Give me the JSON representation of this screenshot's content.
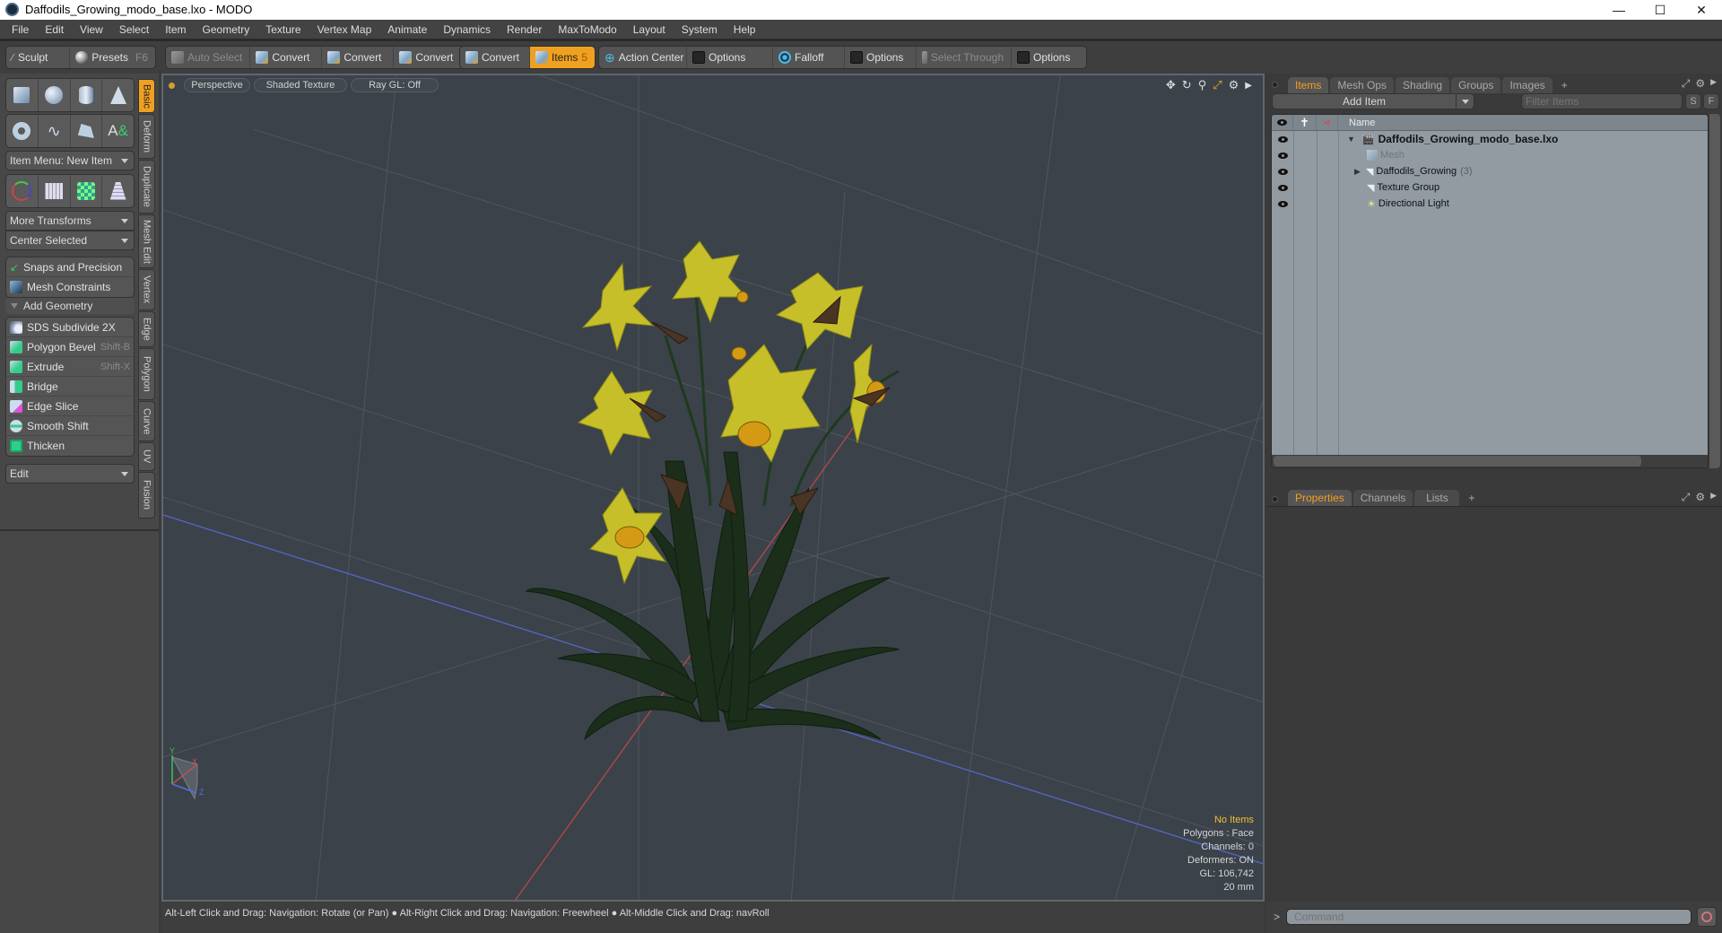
{
  "window": {
    "title": "Daffodils_Growing_modo_base.lxo - MODO",
    "controls": [
      "minimize",
      "maximize",
      "close"
    ]
  },
  "menu": [
    "File",
    "Edit",
    "View",
    "Select",
    "Item",
    "Geometry",
    "Texture",
    "Vertex Map",
    "Animate",
    "Dynamics",
    "Render",
    "MaxToModo",
    "Layout",
    "System",
    "Help"
  ],
  "toolbar": {
    "sculpt": "Sculpt",
    "presets": "Presets",
    "presets_key": "F6",
    "auto_select": "Auto Select",
    "convert1": "Convert",
    "convert2": "Convert",
    "convert3": "Convert",
    "convert4": "Convert",
    "items": "Items",
    "items_key": "5",
    "action_center": "Action Center",
    "options1": "Options",
    "falloff": "Falloff",
    "options2": "Options",
    "select_through": "Select Through",
    "options3": "Options",
    "accent_color": "#f0a020"
  },
  "left_panel": {
    "item_menu": "Item Menu: New Item",
    "more_transforms": "More Transforms",
    "center_selected": "Center Selected",
    "snaps": "Snaps and Precision",
    "mesh_constraints": "Mesh Constraints",
    "add_geometry": "Add Geometry",
    "tools": [
      {
        "label": "SDS Subdivide 2X",
        "shortcut": ""
      },
      {
        "label": "Polygon Bevel",
        "shortcut": "Shift-B"
      },
      {
        "label": "Extrude",
        "shortcut": "Shift-X"
      },
      {
        "label": "Bridge",
        "shortcut": ""
      },
      {
        "label": "Edge Slice",
        "shortcut": ""
      },
      {
        "label": "Smooth Shift",
        "shortcut": ""
      },
      {
        "label": "Thicken",
        "shortcut": ""
      }
    ],
    "edit_dropdown": "Edit",
    "vertical_tabs": [
      "Basic",
      "Deform",
      "Duplicate",
      "Mesh Edit",
      "Vertex",
      "Edge",
      "Polygon",
      "Curve",
      "UV",
      "Fusion"
    ],
    "active_tab": "Basic"
  },
  "viewport": {
    "view": "Perspective",
    "shading": "Shaded Texture",
    "raygl": "Ray GL: Off",
    "info": {
      "selection": "No Items",
      "polygons": "Polygons : Face",
      "channels": "Channels: 0",
      "deformers": "Deformers: ON",
      "gl": "GL: 106,742",
      "scale": "20 mm"
    },
    "axis_labels": {
      "x": "X",
      "y": "Y",
      "z": "Z"
    }
  },
  "status": {
    "hint1": "Alt-Left Click and Drag: Navigation: Rotate (or Pan)",
    "hint2": "Alt-Right Click and Drag: Navigation: Freewheel",
    "hint3": "Alt-Middle Click and Drag: navRoll"
  },
  "items_panel": {
    "tabs": [
      "Items",
      "Mesh Ops",
      "Shading",
      "Groups",
      "Images"
    ],
    "active_tab": "Items",
    "add_item": "Add Item",
    "filter_placeholder": "Filter Items",
    "btn_s": "S",
    "btn_f": "F",
    "col_name": "Name",
    "tree": [
      {
        "name": "Daffodils_Growing_modo_base.lxo",
        "type": "scene",
        "level": 0,
        "expanded": true,
        "bold": true
      },
      {
        "name": "Mesh",
        "type": "mesh",
        "level": 1,
        "dim": true
      },
      {
        "name": "Daffodils_Growing",
        "count": "(3)",
        "type": "group",
        "level": 1,
        "expandable": true
      },
      {
        "name": "Texture Group",
        "type": "group",
        "level": 1
      },
      {
        "name": "Directional Light",
        "type": "light",
        "level": 1
      }
    ]
  },
  "properties_panel": {
    "tabs": [
      "Properties",
      "Channels",
      "Lists"
    ],
    "active_tab": "Properties"
  },
  "command": {
    "prompt": ">",
    "placeholder": "Command"
  }
}
